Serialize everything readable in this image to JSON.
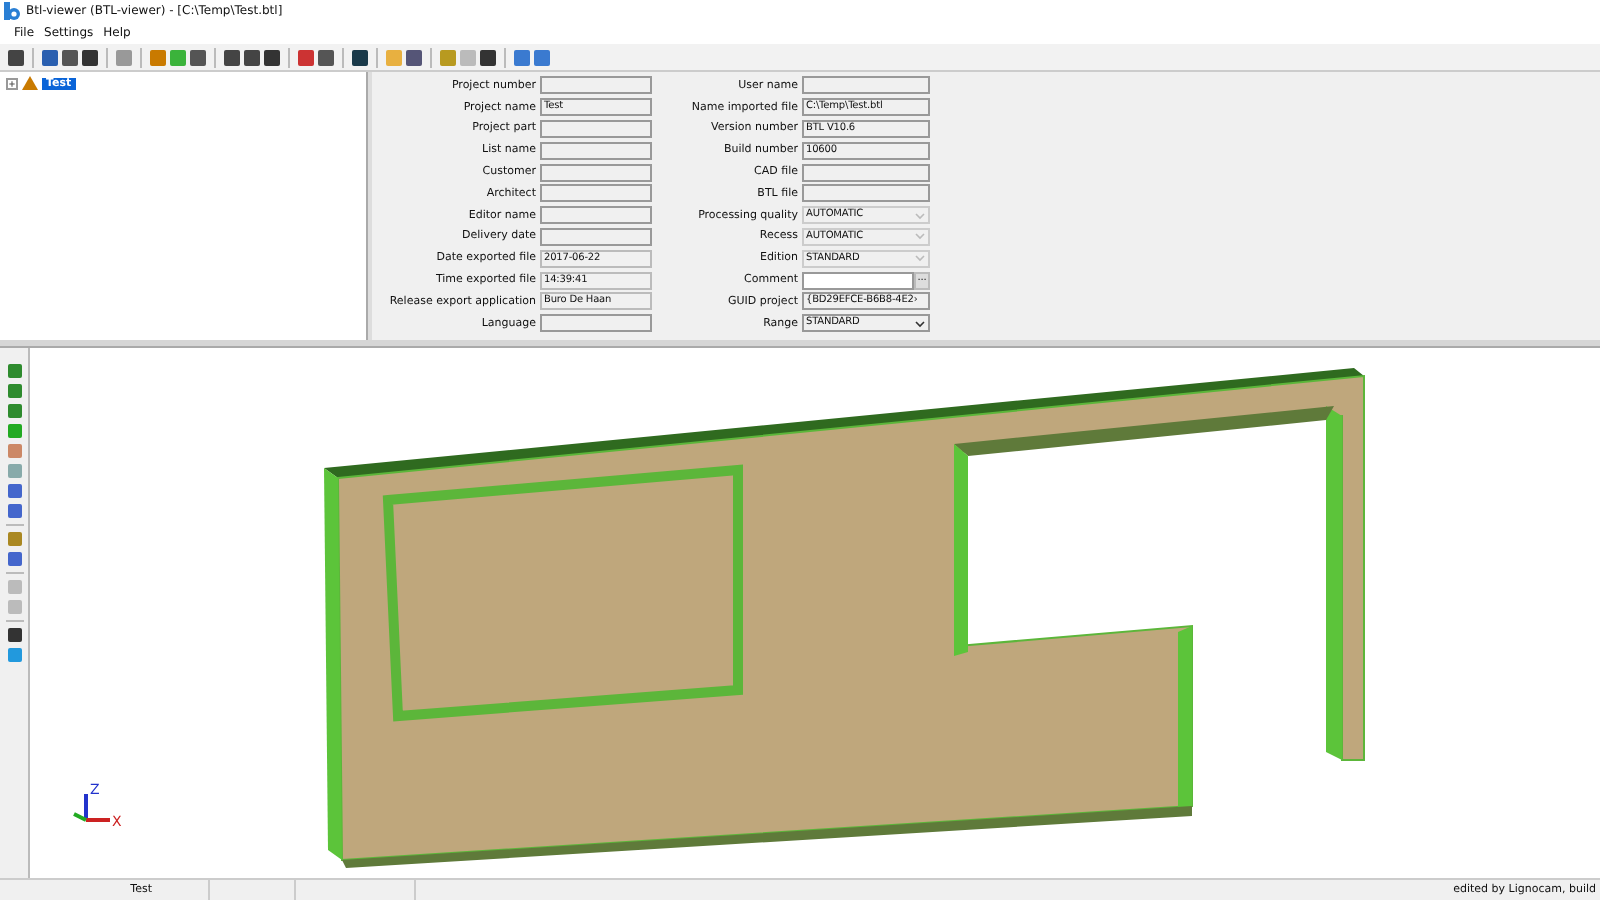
{
  "window": {
    "title": "Btl-viewer (BTL-viewer) - [C:\\Temp\\Test.btl]"
  },
  "menu": [
    {
      "label": "File"
    },
    {
      "label": "Settings"
    },
    {
      "label": "Help"
    }
  ],
  "tree": {
    "items": [
      {
        "label": "Test",
        "selected": true,
        "expanded": false
      }
    ]
  },
  "form": {
    "left": [
      {
        "label": "Project number",
        "kind": "text"
      },
      {
        "label": "Project name",
        "value": "Test",
        "kind": "text"
      },
      {
        "label": "Project part",
        "kind": "text"
      },
      {
        "label": "List name",
        "kind": "text"
      },
      {
        "label": "Customer",
        "kind": "text"
      },
      {
        "label": "Architect",
        "kind": "text"
      },
      {
        "label": "Editor name",
        "kind": "text"
      },
      {
        "label": "Delivery date",
        "kind": "text"
      },
      {
        "label": "Date exported file",
        "value": "2017-06-22",
        "kind": "readonly"
      },
      {
        "label": "Time exported file",
        "value": "14:39:41",
        "kind": "readonly"
      },
      {
        "label": "Release export application",
        "value": "Buro De Haan",
        "kind": "readonly"
      },
      {
        "label": "Language",
        "kind": "text"
      }
    ],
    "right": [
      {
        "label": "User name",
        "kind": "text"
      },
      {
        "label": "Name imported file",
        "value": "C:\\Temp\\Test.btl",
        "kind": "text"
      },
      {
        "label": "Version number",
        "value": "BTL V10.6",
        "kind": "text"
      },
      {
        "label": "Build number",
        "value": "10600",
        "kind": "text"
      },
      {
        "label": "CAD file",
        "kind": "text"
      },
      {
        "label": "BTL file",
        "kind": "text"
      },
      {
        "label": "Processing quality",
        "value": "AUTOMATIC",
        "kind": "combo",
        "disabled": true
      },
      {
        "label": "Recess",
        "value": "AUTOMATIC",
        "kind": "combo",
        "disabled": true
      },
      {
        "label": "Edition",
        "value": "STANDARD",
        "kind": "combo",
        "disabled": true
      },
      {
        "label": "Comment",
        "kind": "browse",
        "button": "..."
      },
      {
        "label": "GUID project",
        "value": "{BD29EFCE-B6B8-4E2›",
        "kind": "text"
      },
      {
        "label": "Range",
        "value": "STANDARD",
        "kind": "combo",
        "disabled": false
      }
    ]
  },
  "view": {
    "axis_labels": [
      "Z",
      "X"
    ]
  },
  "status_bar": {
    "panels": [
      "Test"
    ],
    "right": "edited by Lignocam, build"
  }
}
